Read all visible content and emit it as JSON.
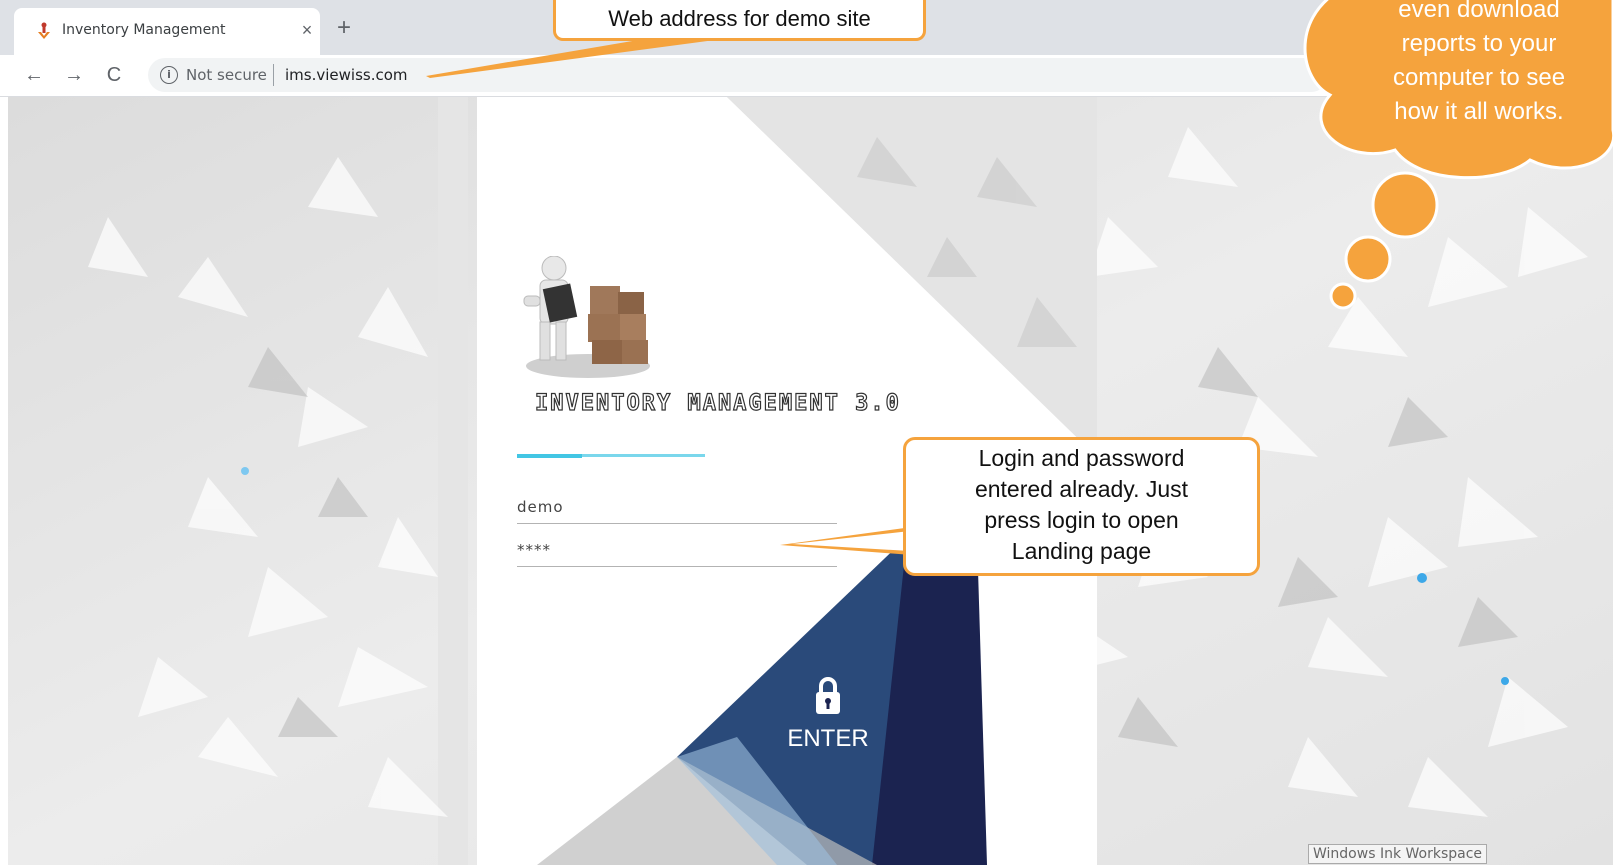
{
  "browser": {
    "tab_title": "Inventory Management",
    "tab_close": "×",
    "new_tab": "+",
    "nav_back": "←",
    "nav_forward": "→",
    "nav_reload": "C",
    "security_label": "Not secure",
    "url": "ims.viewiss.com"
  },
  "login_page": {
    "app_title": "INVENTORY MANAGEMENT 3.0",
    "username_value": "demo",
    "password_value": "****",
    "enter_label": "ENTER"
  },
  "annotations": {
    "web_address_callout": "Web address for demo site",
    "login_callout": [
      "Login and password",
      "entered already. Just",
      "press login to open",
      "Landing page"
    ],
    "thought_bubble": [
      "even download",
      "reports to your",
      "computer to see",
      "how it all works."
    ]
  },
  "taskbar": {
    "ink_workspace": "Windows Ink Workspace"
  },
  "colors": {
    "accent_orange": "#f5a33d",
    "enter_dark": "#1b2350",
    "enter_mid": "#2a4a7a",
    "accent_cyan": "#42c6e4"
  }
}
